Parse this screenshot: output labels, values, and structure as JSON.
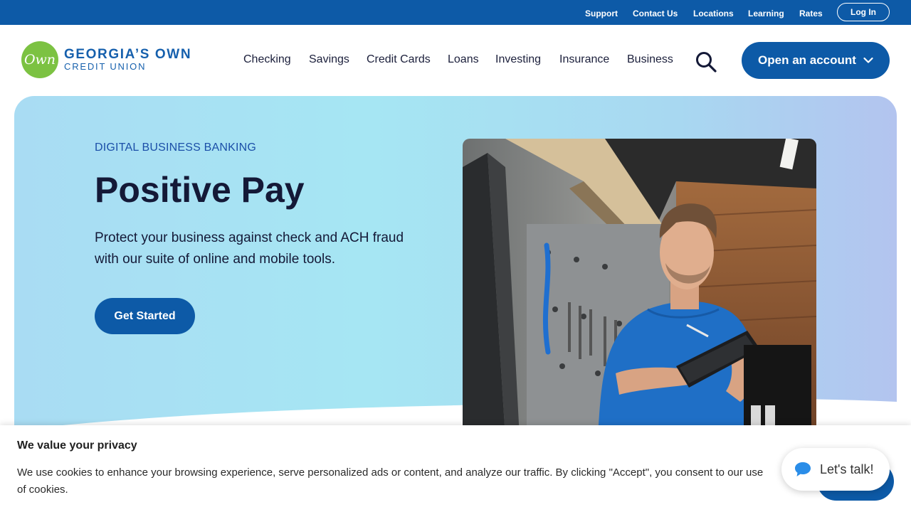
{
  "utility_nav": {
    "support": "Support",
    "contact_us": "Contact Us",
    "locations": "Locations",
    "learning": "Learning",
    "rates": "Rates",
    "login": "Log In"
  },
  "brand": {
    "logo_mark": "Own",
    "name_line1": "GEORGIA’S OWN",
    "name_line2": "CREDIT UNION",
    "primary_color": "#0d5aa7",
    "logo_color": "#7cc242"
  },
  "main_nav": {
    "items": [
      {
        "label": "Checking"
      },
      {
        "label": "Savings"
      },
      {
        "label": "Credit Cards"
      },
      {
        "label": "Loans"
      },
      {
        "label": "Investing"
      },
      {
        "label": "Insurance"
      },
      {
        "label": "Business"
      }
    ],
    "search_icon": "search-icon",
    "cta_label": "Open an account",
    "cta_icon": "chevron-down-icon"
  },
  "hero": {
    "eyebrow": "DIGITAL BUSINESS BANKING",
    "title": "Positive Pay",
    "description": "Protect your business against check and ACH fraud with our suite of online and mobile tools.",
    "button_label": "Get Started",
    "image": "man-with-tablet-in-bike-shop"
  },
  "cookie_banner": {
    "title": "We value your privacy",
    "text": "We use cookies to enhance your browsing experience, serve personalized ads or content, and analyze our traffic. By clicking \"Accept\", you consent to our use of cookies."
  },
  "chat": {
    "label": "Let's talk!",
    "icon": "chat-bubble-icon"
  }
}
